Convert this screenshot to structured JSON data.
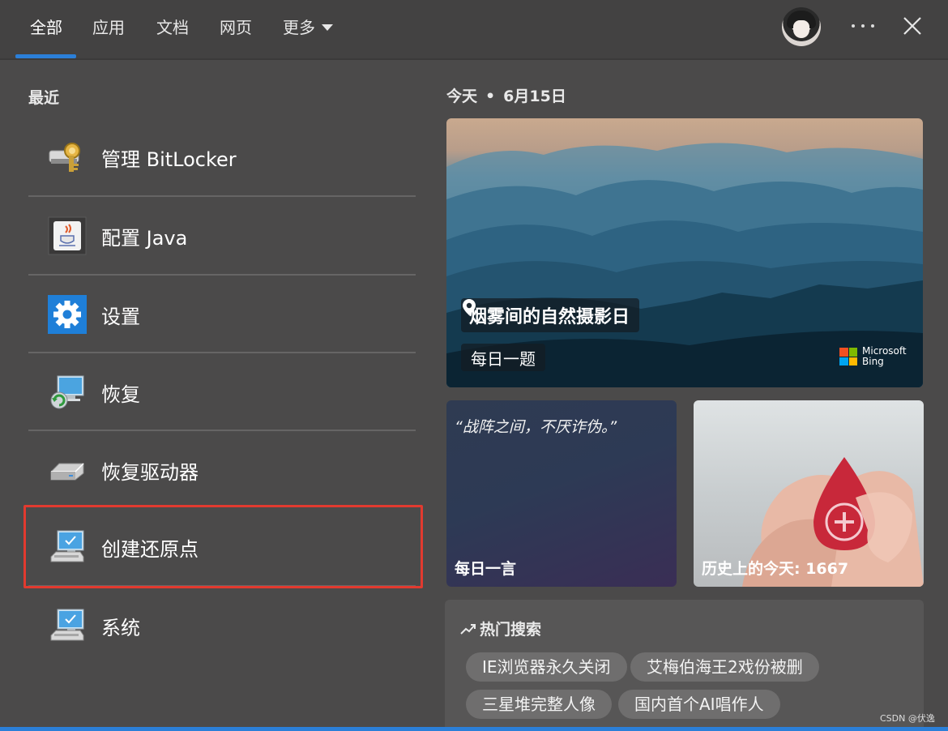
{
  "tabs": [
    {
      "label": "全部",
      "active": true
    },
    {
      "label": "应用"
    },
    {
      "label": "文档"
    },
    {
      "label": "网页"
    },
    {
      "label": "更多"
    }
  ],
  "recent": {
    "title": "最近",
    "items": [
      {
        "label": "管理 BitLocker",
        "icon": "bitlocker-key-icon"
      },
      {
        "label": "配置 Java",
        "icon": "java-icon"
      },
      {
        "label": "设置",
        "icon": "gear-icon"
      },
      {
        "label": "恢复",
        "icon": "recovery-icon"
      },
      {
        "label": "恢复驱动器",
        "icon": "drive-icon"
      },
      {
        "label": "创建还原点",
        "icon": "system-monitor-icon",
        "highlighted": true
      },
      {
        "label": "系统",
        "icon": "system-monitor-icon"
      }
    ]
  },
  "today": {
    "label": "今天",
    "date": "6月15日",
    "hero": {
      "location": "烟雾间的自然摄影日",
      "quiz": "每日一题",
      "brand_line1": "Microsoft",
      "brand_line2": "Bing"
    },
    "quote_card": {
      "quote": "“战阵之间，不厌诈伪。”",
      "caption": "每日一言"
    },
    "history_card": {
      "caption": "历史上的今天: 1667"
    }
  },
  "hot_search": {
    "title": "热门搜索",
    "chips": [
      "IE浏览器永久关闭",
      "艾梅伯海王2戏份被删",
      "三星堆完整人像",
      "国内首个AI唱作人"
    ]
  },
  "watermark": "CSDN @伏逸",
  "colors": {
    "accent": "#2b7fd8",
    "highlight": "#e23a2f",
    "background": "#4b4a4a"
  }
}
